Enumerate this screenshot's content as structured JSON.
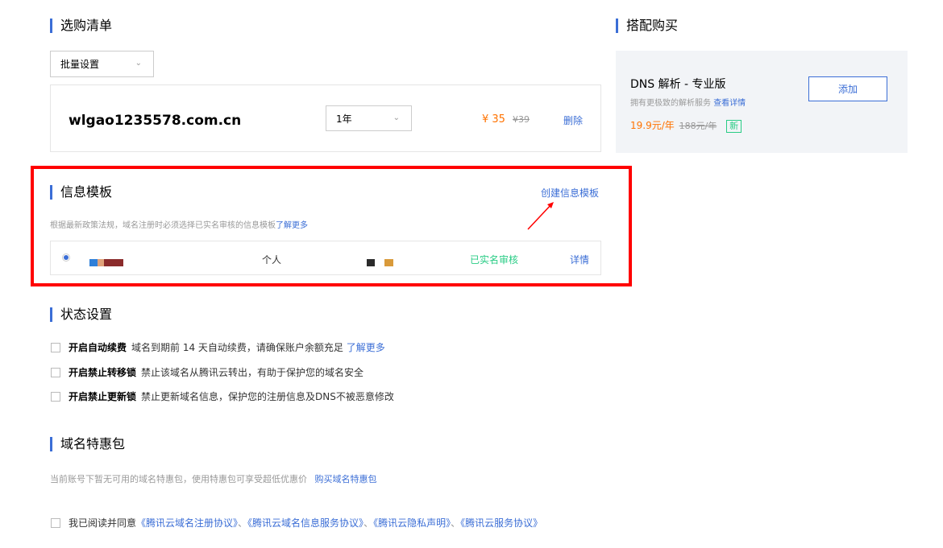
{
  "cart": {
    "title": "选购清单",
    "batch_select": "批量设置",
    "domain": "wlgao1235578.com.cn",
    "period": "1年",
    "price": "¥ 35",
    "original_price": "¥39",
    "delete": "删除"
  },
  "addon": {
    "title": "搭配购买",
    "product": "DNS 解析 - 专业版",
    "desc": "拥有更极致的解析服务",
    "detail_link": "查看详情",
    "price": "19.9元/年",
    "original_price": "188元/年",
    "badge": "新",
    "add_button": "添加"
  },
  "template": {
    "title": "信息模板",
    "create_link": "创建信息模板",
    "notice": "根据最新政策法规，域名注册时必须选择已实名审核的信息模板",
    "learn_more": "了解更多",
    "row": {
      "type": "个人",
      "status": "已实名审核",
      "detail": "详情"
    }
  },
  "status": {
    "title": "状态设置",
    "items": [
      {
        "label": "开启自动续费",
        "desc": "域名到期前 14 天自动续费，请确保账户余额充足",
        "link": "了解更多"
      },
      {
        "label": "开启禁止转移锁",
        "desc": "禁止该域名从腾讯云转出，有助于保护您的域名安全",
        "link": ""
      },
      {
        "label": "开启禁止更新锁",
        "desc": "禁止更新域名信息，保护您的注册信息及DNS不被恶意修改",
        "link": ""
      }
    ]
  },
  "package": {
    "title": "域名特惠包",
    "desc": "当前账号下暂无可用的域名特惠包，使用特惠包可享受超低优惠价",
    "buy_link": "购买域名特惠包"
  },
  "agreement": {
    "prefix": "我已阅读并同意",
    "links": [
      "《腾讯云域名注册协议》",
      "《腾讯云域名信息服务协议》",
      "《腾讯云隐私声明》",
      "《腾讯云服务协议》"
    ],
    "sep": "、"
  },
  "colors": {
    "accent": "#3b6ed6",
    "price": "#ff7200",
    "success": "#29cc85",
    "highlight_border": "#ff0000"
  }
}
